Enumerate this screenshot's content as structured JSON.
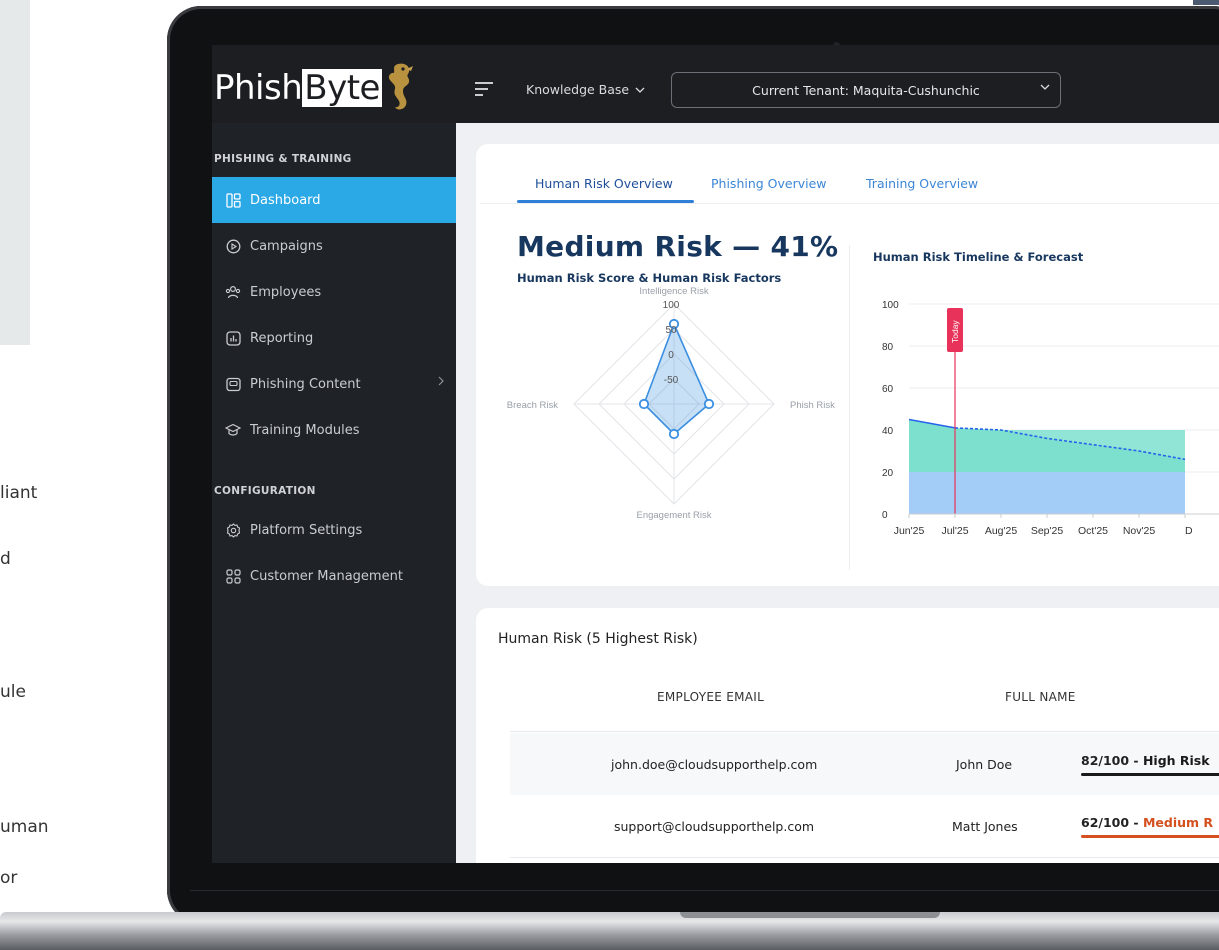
{
  "background": {
    "fragments": [
      "liant",
      "d",
      "ule",
      "uman",
      "or"
    ]
  },
  "app": {
    "logo": {
      "part1": "Phish",
      "part2": "Byte"
    },
    "topbar": {
      "knowledge_base": "Knowledge Base",
      "tenant": "Current Tenant: Maquita-Cushunchic"
    },
    "sidebar": {
      "section1": "PHISHING & TRAINING",
      "section2": "CONFIGURATION",
      "items": [
        {
          "label": "Dashboard",
          "icon": "dashboard-icon",
          "active": true
        },
        {
          "label": "Campaigns",
          "icon": "play-circle-icon"
        },
        {
          "label": "Employees",
          "icon": "users-icon"
        },
        {
          "label": "Reporting",
          "icon": "chart-icon"
        },
        {
          "label": "Phishing Content",
          "icon": "mail-icon",
          "has_submenu": true
        },
        {
          "label": "Training Modules",
          "icon": "graduation-cap-icon"
        },
        {
          "label": "Platform Settings",
          "icon": "gear-icon"
        },
        {
          "label": "Customer Management",
          "icon": "grid-icon"
        }
      ]
    },
    "tabs": [
      "Human Risk Overview",
      "Phishing Overview",
      "Training Overview"
    ],
    "risk": {
      "headline": "Medium Risk — 41%",
      "subtitle": "Human Risk Score & Human Risk Factors"
    },
    "timeline_title": "Human Risk Timeline & Forecast",
    "table": {
      "title": "Human Risk (5 Highest Risk)",
      "headers": [
        "EMPLOYEE EMAIL",
        "FULL NAME"
      ],
      "rows": [
        {
          "email": "john.doe@cloudsupporthelp.com",
          "name": "John Doe",
          "score_num": "82/100 - ",
          "score_word": "High Risk",
          "score": 82,
          "color": "#1a1a1a"
        },
        {
          "email": "support@cloudsupporthelp.com",
          "name": "Matt Jones",
          "score_num": "62/100 - ",
          "score_word": "Medium R",
          "score": 62,
          "color": "#d4501f"
        }
      ]
    }
  },
  "chart_data": [
    {
      "type": "radar",
      "axes": [
        "Intelligence Risk",
        "Phish Risk",
        "Engagement Risk",
        "Breach Risk"
      ],
      "ticks": [
        "100",
        "50",
        "0",
        "-50"
      ],
      "range": [
        -100,
        100
      ],
      "values": [
        60,
        -30,
        -40,
        -40
      ],
      "color": "#3b8fe0"
    },
    {
      "type": "area",
      "x": [
        "Jun'25",
        "Jul'25",
        "Aug'25",
        "Sep'25",
        "Oct'25",
        "Nov'25",
        "D"
      ],
      "ylim": [
        0,
        100
      ],
      "yticks": [
        0,
        20,
        40,
        60,
        80,
        100
      ],
      "marker": {
        "label": "Today",
        "x": "Jul'25"
      },
      "series": [
        {
          "values": [
            45,
            41,
            40,
            36,
            33,
            30,
            26
          ]
        },
        {
          "values": [
            20,
            20,
            20,
            20,
            20,
            20,
            20
          ]
        },
        {
          "values": [
            40,
            40,
            40,
            40,
            40,
            40,
            40
          ]
        }
      ],
      "colors": {
        "line": "#2563eb",
        "upper": "#7de0cf",
        "lower": "#a3cdf7",
        "marker": "#e8325a"
      }
    }
  ]
}
